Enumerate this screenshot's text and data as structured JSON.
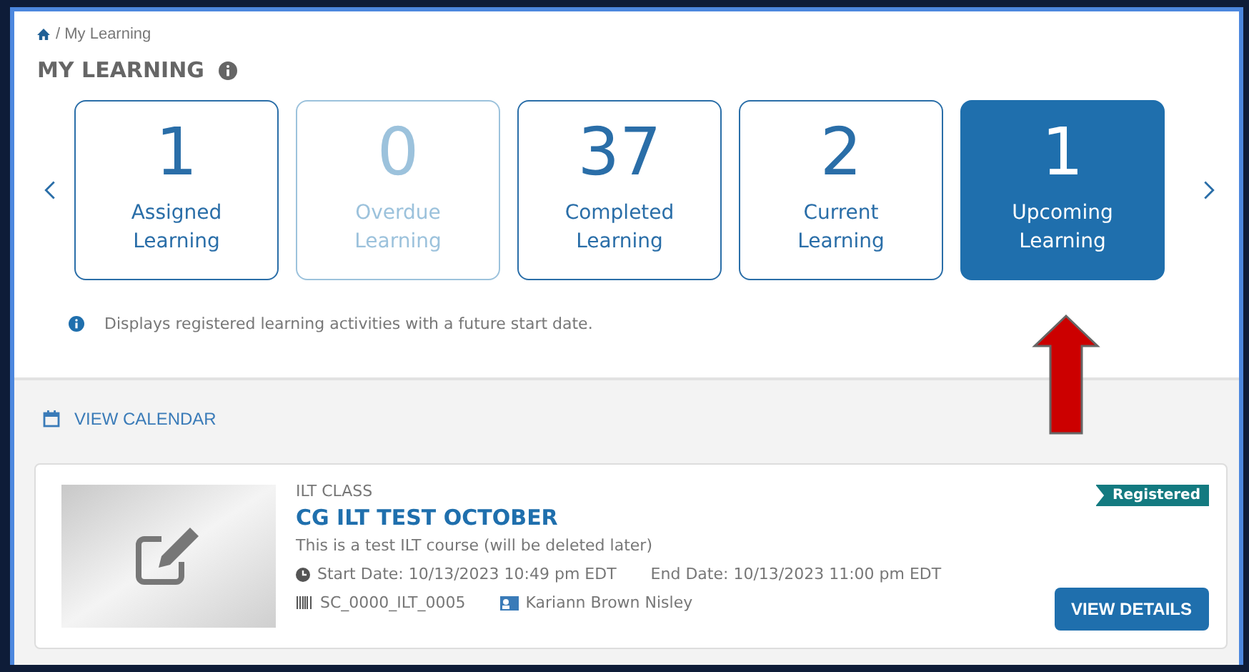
{
  "breadcrumb": {
    "path": "/ My Learning"
  },
  "title": "MY LEARNING",
  "tiles": [
    {
      "count": "1",
      "label": "Assigned Learning",
      "disabled": false,
      "selected": false
    },
    {
      "count": "0",
      "label": "Overdue Learning",
      "disabled": true,
      "selected": false
    },
    {
      "count": "37",
      "label": "Completed Learning",
      "disabled": false,
      "selected": false
    },
    {
      "count": "2",
      "label": "Current Learning",
      "disabled": false,
      "selected": false
    },
    {
      "count": "1",
      "label": "Upcoming Learning",
      "disabled": false,
      "selected": true
    }
  ],
  "hint": "Displays registered learning activities with a future start date.",
  "calendar_link": "VIEW CALENDAR",
  "course": {
    "type": "ILT CLASS",
    "title": "CG ILT TEST OCTOBER",
    "description": "This is a test ILT course (will be deleted later)",
    "start": "Start Date: 10/13/2023 10:49 pm EDT",
    "end": "End Date: 10/13/2023 11:00 pm EDT",
    "code": "SC_0000_ILT_0005",
    "instructor": "Kariann Brown Nisley",
    "status": "Registered",
    "button": "VIEW DETAILS"
  }
}
